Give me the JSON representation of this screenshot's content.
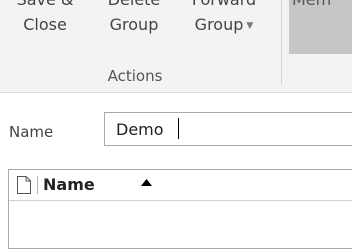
{
  "ribbon": {
    "save_close": {
      "line1": "Save &",
      "line2": "Close"
    },
    "delete_group": {
      "line1": "Delete",
      "line2": "Group"
    },
    "forward_group": {
      "line1": "Forward",
      "line2": "Group"
    },
    "members": {
      "line1": "Mem"
    },
    "group_label": "Actions"
  },
  "form": {
    "name_label": "Name",
    "name_value": "Demo"
  },
  "list": {
    "column_name": "Name",
    "sort": "ascending"
  },
  "icons": [
    "document-icon",
    "sort-ascending-icon",
    "chevron-down-icon"
  ],
  "colors": {
    "ribbon_bg": "#f3f3f3",
    "button_pressed": "#c6c6c6",
    "border": "#a9a9a9"
  }
}
